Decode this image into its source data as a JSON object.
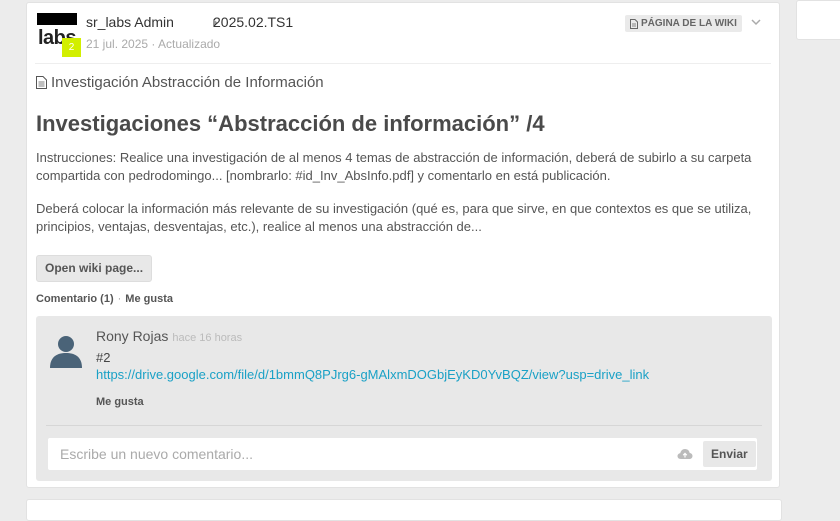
{
  "post": {
    "avatar_text": "labs",
    "avatar_badge": "2",
    "author": "sr_labs Admin",
    "group": "2025.02.TS1",
    "meta": "21 jul. 2025 · Actualizado",
    "wiki_badge": "PÁGINA DE LA WIKI",
    "doc_title": "Investigación Abstracción de Información",
    "title": "Investigaciones “Abstracción de información” /4",
    "paragraph1": "Instrucciones: Realice una investigación de al menos 4 temas de abstracción de información, deberá de subirlo a su carpeta compartida con pedrodomingo... [nombrarlo: #id_Inv_AbsInfo.pdf] y comentarlo en está publicación.",
    "paragraph2": "Deberá colocar la información más relevante de su investigación (qué es, para que sirve, en que contextos es que se utiliza, principios, ventajas, desventajas, etc.), realice al menos una abstracción de...",
    "open_wiki_label": "Open wiki page...",
    "comment_count_label": "Comentario (1)",
    "like_label": "Me gusta"
  },
  "comment": {
    "author": "Rony Rojas",
    "time": "hace 16 horas",
    "text": "#2",
    "link": "https://drive.google.com/file/d/1bmmQ8PJrg6-gMAlxmDOGbjEyKD0YvBQZ/view?usp=drive_link",
    "like_label": "Me gusta"
  },
  "new_comment": {
    "placeholder": "Escribe un nuevo comentario...",
    "send_label": "Enviar"
  },
  "icons": [
    "document-icon",
    "chevron-down-icon",
    "user-avatar-icon",
    "cloud-upload-icon"
  ],
  "colors": {
    "accent_link": "#1aa1c6",
    "badge": "#d2ef00"
  }
}
